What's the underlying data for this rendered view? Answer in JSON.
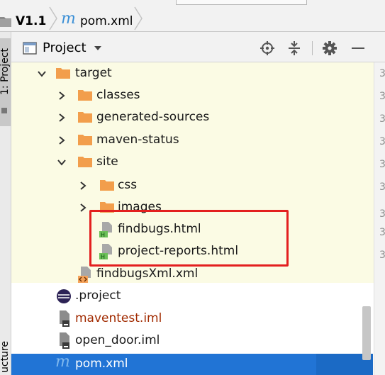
{
  "breadcrumb": {
    "project": "V1.1",
    "file": "pom.xml"
  },
  "panel": {
    "title": "Project"
  },
  "stripe": {
    "tab_project": "1: Project",
    "tab_structure": "ucture"
  },
  "tree": [
    {
      "label": "target",
      "type": "folder",
      "expanded": true
    },
    {
      "label": "classes",
      "type": "folder",
      "expanded": false
    },
    {
      "label": "generated-sources",
      "type": "folder",
      "expanded": false
    },
    {
      "label": "maven-status",
      "type": "folder",
      "expanded": false
    },
    {
      "label": "site",
      "type": "folder",
      "expanded": true
    },
    {
      "label": "css",
      "type": "folder",
      "expanded": false
    },
    {
      "label": "images",
      "type": "folder",
      "expanded": false
    },
    {
      "label": "findbugs.html",
      "type": "html-file"
    },
    {
      "label": "project-reports.html",
      "type": "html-file"
    },
    {
      "label": "findbugsXml.xml",
      "type": "xml-file"
    },
    {
      "label": ".project",
      "type": "eclipse-file"
    },
    {
      "label": "maventest.iml",
      "type": "iml-file",
      "color": "#a12a00"
    },
    {
      "label": "open_door.iml",
      "type": "iml-file"
    },
    {
      "label": "pom.xml",
      "type": "maven-file",
      "selected": true
    }
  ],
  "gutter": [
    "3",
    "3",
    "3",
    "3",
    "3",
    "3",
    "3",
    "3",
    "3"
  ],
  "colors": {
    "folder": "#f29e4c",
    "selection": "#1b6ac5",
    "highlight_box": "#e31f1f",
    "tree_background": "#fbfbe4",
    "maven_m": "#3a8fd6"
  },
  "icons": {
    "locate": "crosshair-icon",
    "collapse": "collapse-all-icon",
    "settings": "gear-icon",
    "hide": "minimize-icon",
    "dropdown": "chevron-down-icon"
  }
}
